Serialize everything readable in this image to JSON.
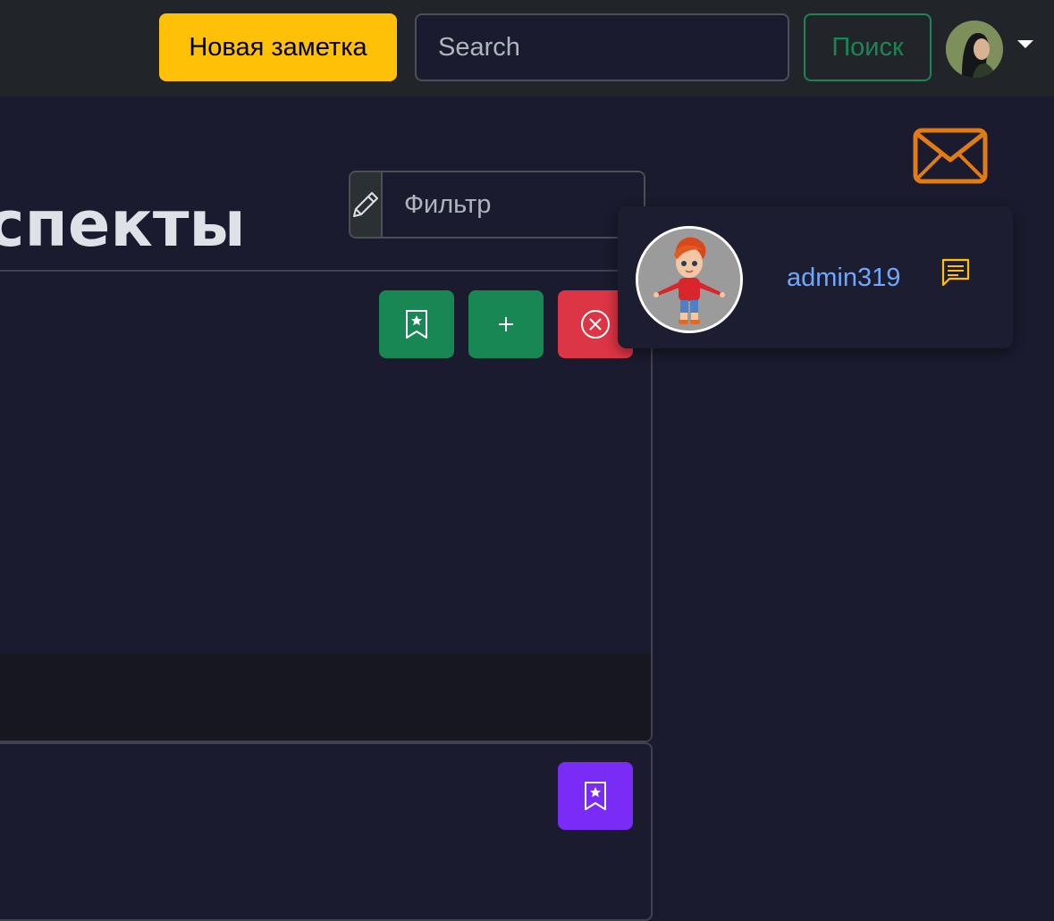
{
  "navbar": {
    "new_note_label": "Новая заметка",
    "search_placeholder": "Search",
    "search_button_label": "Поиск"
  },
  "main": {
    "title": "спекты",
    "filter_placeholder": "Фильтр"
  },
  "user_card": {
    "username": "admin319"
  },
  "icons": {
    "mail": "envelope-icon",
    "pencil": "pencil-icon",
    "bookmark": "bookmark-star-icon",
    "plus": "plus-icon",
    "close": "x-circle-icon",
    "chat": "chat-lines-icon",
    "caret": "caret-down-icon"
  },
  "colors": {
    "warning": "#ffc107",
    "success": "#198754",
    "danger": "#dc3545",
    "purple": "#7a2cf7",
    "link": "#6ea8fe",
    "mail_orange": "#e07b17",
    "chat_yellow": "#ffc107",
    "navbar_bg": "#212529",
    "body_bg": "#1a1b2e"
  }
}
